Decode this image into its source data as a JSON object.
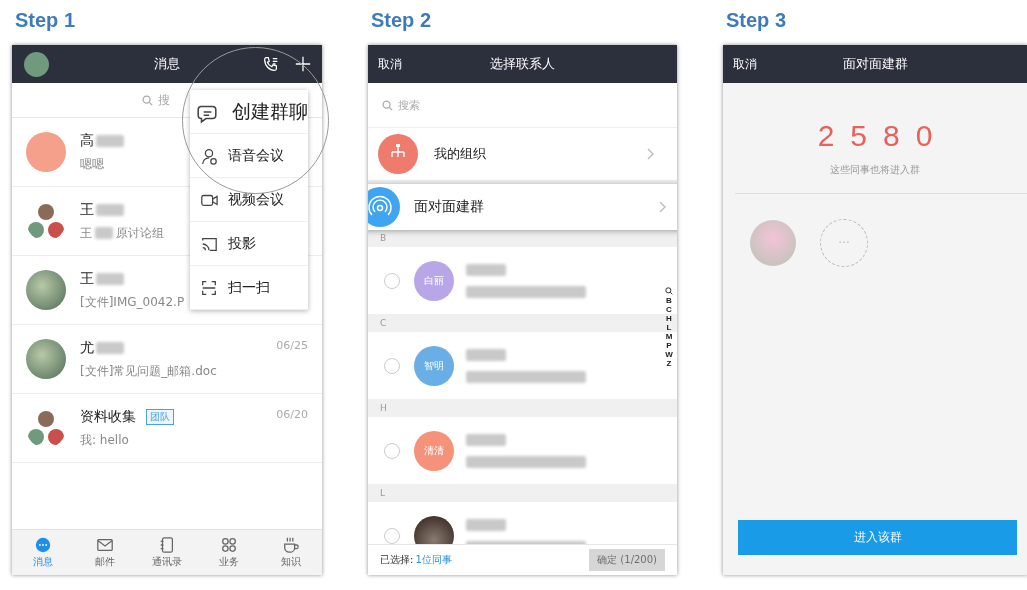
{
  "steps": [
    {
      "label": "Step 1",
      "kind": "messages",
      "screen": {
        "title": "消息",
        "search": {
          "placeholder": "搜"
        },
        "chats": [
          {
            "name": "高",
            "blurred": true,
            "preview": "嗯嗯",
            "avatar": {
              "kind": "solid",
              "color": "#f4a08a"
            }
          },
          {
            "name": "王",
            "blurred": true,
            "sender": "王",
            "preview": "原讨论组",
            "avatar": {
              "kind": "group"
            }
          },
          {
            "name": "王",
            "blurred": true,
            "preview": "[文件]IMG_0042.P",
            "avatar": {
              "kind": "photo"
            }
          },
          {
            "name": "尤",
            "blurred": true,
            "preview": "[文件]常见问题_邮箱.doc",
            "time": "06/25",
            "avatar": {
              "kind": "photo"
            }
          },
          {
            "name": "资料收集",
            "blurred": false,
            "badge": "团队",
            "preview": "我: hello",
            "time": "06/20",
            "avatar": {
              "kind": "group"
            }
          }
        ],
        "menu": [
          {
            "label": "创建群聊",
            "kind": "chat",
            "magnified": true
          },
          {
            "label": "语音会议",
            "kind": "voice",
            "magnified": false
          },
          {
            "label": "视频会议",
            "kind": "video",
            "magnified": false
          },
          {
            "label": "投影",
            "kind": "cast",
            "magnified": false
          },
          {
            "label": "扫一扫",
            "kind": "scan",
            "magnified": false
          }
        ],
        "nav": [
          {
            "label": "消息",
            "kind": "chat",
            "selected": true
          },
          {
            "label": "邮件",
            "kind": "mail",
            "selected": false
          },
          {
            "label": "通讯录",
            "kind": "book",
            "selected": false
          },
          {
            "label": "业务",
            "kind": "apps",
            "selected": false
          },
          {
            "label": "知识",
            "kind": "cup",
            "selected": false
          }
        ]
      }
    },
    {
      "label": "Step 2",
      "kind": "contacts",
      "screen": {
        "cancel": "取消",
        "title": "选择联系人",
        "search": {
          "placeholder": "搜索"
        },
        "org": "我的组织",
        "highlight": "面对面建群",
        "sections": [
          {
            "letter": "B",
            "contacts": [
              {
                "avatar_text": "白丽",
                "color": "#b9a6e8",
                "checked": false
              }
            ]
          },
          {
            "letter": "C",
            "contacts": [
              {
                "avatar_text": "智明",
                "color": "#6aaee6",
                "checked": false
              }
            ]
          },
          {
            "letter": "H",
            "contacts": [
              {
                "avatar_text": "清清",
                "color": "#f4927a",
                "checked": false
              }
            ]
          },
          {
            "letter": "L",
            "contacts": [
              {
                "photo": true,
                "checked": false
              }
            ]
          }
        ],
        "index": [
          "B",
          "C",
          "H",
          "L",
          "M",
          "P",
          "W",
          "Z"
        ],
        "selected_label": "已选择:",
        "selected_count": "1位同事",
        "confirm": {
          "label": "确定 (1/200)",
          "disabled": true
        }
      }
    },
    {
      "label": "Step 3",
      "kind": "face",
      "screen": {
        "cancel": "取消",
        "title": "面对面建群",
        "code": "2580",
        "hint": "这些同事也将进入群",
        "members": [
          {
            "kind": "photo"
          },
          {
            "kind": "more",
            "label": "···"
          }
        ],
        "button": "进入该群"
      }
    }
  ]
}
